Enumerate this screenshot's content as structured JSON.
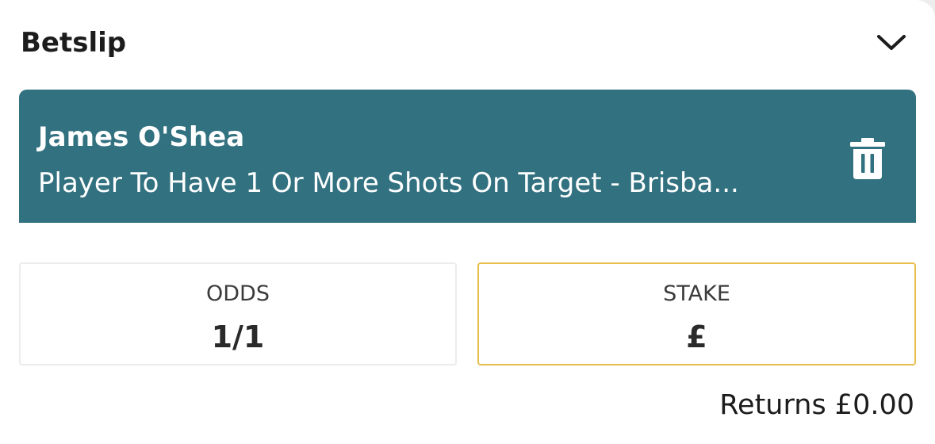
{
  "betslip": {
    "title": "Betslip",
    "collapse_icon": "chevron-down-icon"
  },
  "selection": {
    "player": "James O'Shea",
    "market": "Player To Have 1 Or More Shots On Target - Brisba...",
    "delete_icon": "trash-icon",
    "accent_color": "#327180"
  },
  "odds": {
    "label": "ODDS",
    "value": "1/1"
  },
  "stake": {
    "label": "STAKE",
    "currency": "£",
    "highlight_color": "#e8bf4e"
  },
  "returns": {
    "text": "Returns £0.00"
  }
}
